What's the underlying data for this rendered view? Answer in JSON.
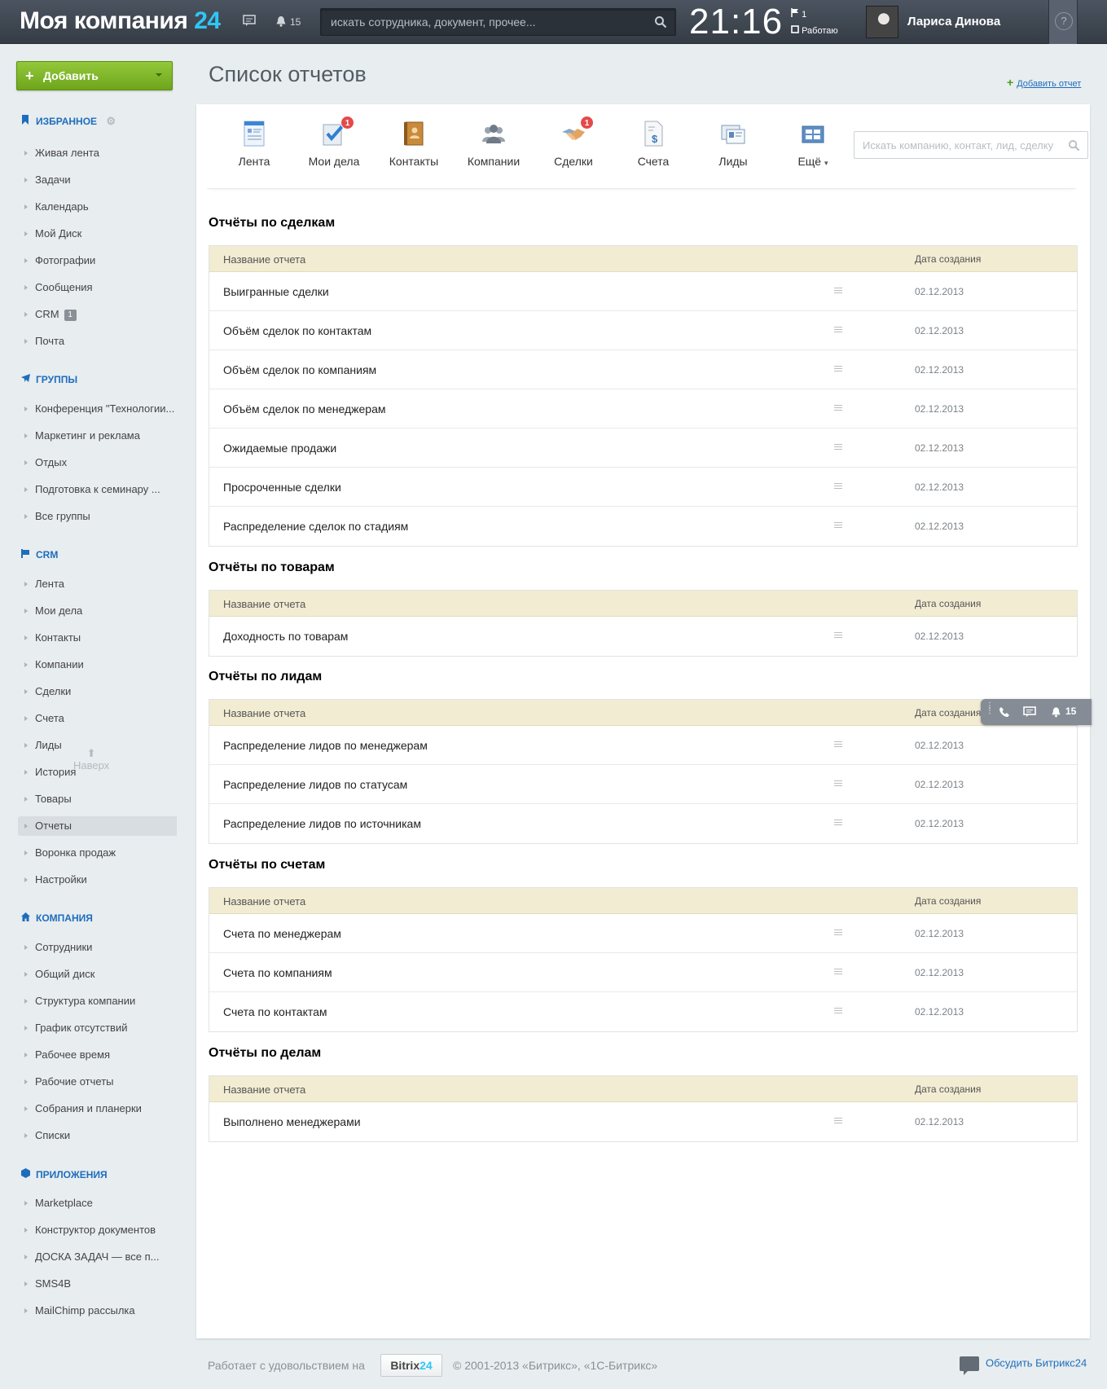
{
  "header": {
    "logo_name": "Моя компания",
    "logo_num": "24",
    "notifications_count": "15",
    "search_placeholder": "искать сотрудника, документ, прочее...",
    "clock": "21:16",
    "flag_count": "1",
    "work_status": "Работаю",
    "user_name": "Лариса Динова",
    "help": "?"
  },
  "sidebar": {
    "add_button": "Добавить",
    "favorites": {
      "title": "Избранное",
      "items": [
        "Живая лента",
        "Задачи",
        "Календарь",
        "Мой Диск",
        "Фотографии",
        "Сообщения",
        "CRM",
        "Почта"
      ],
      "crm_badge": "1"
    },
    "groups": {
      "title": "Группы",
      "items": [
        "Конференция \"Технологии...",
        "Маркетинг и реклама",
        "Отдых",
        "Подготовка к семинару ...",
        "Все группы"
      ]
    },
    "crm": {
      "title": "CRM",
      "items": [
        "Лента",
        "Мои дела",
        "Контакты",
        "Компании",
        "Сделки",
        "Счета",
        "Лиды",
        "История",
        "Товары",
        "Отчеты",
        "Воронка продаж",
        "Настройки"
      ]
    },
    "to_top": "Наверх",
    "company": {
      "title": "Компания",
      "items": [
        "Сотрудники",
        "Общий диск",
        "Структура компании",
        "График отсутствий",
        "Рабочее время",
        "Рабочие отчеты",
        "Собрания и планерки",
        "Списки"
      ]
    },
    "apps": {
      "title": "Приложения",
      "items": [
        "Marketplace",
        "Конструктор документов",
        "ДОСКА ЗАДАЧ — все п...",
        "SMS4B",
        "MailChimp рассылка"
      ]
    }
  },
  "page": {
    "title": "Список отчетов",
    "add_report": "Добавить отчет"
  },
  "toolbar": {
    "items": [
      "Лента",
      "Мои дела",
      "Контакты",
      "Компании",
      "Сделки",
      "Счета",
      "Лиды",
      "Ещё"
    ],
    "badges": {
      "my_tasks": "1",
      "deals": "1"
    },
    "search_placeholder": "Искать компанию, контакт, лид, сделку"
  },
  "reports": {
    "col_name": "Название отчета",
    "col_date": "Дата создания",
    "groups": [
      {
        "title": "Отчёты по сделкам",
        "rows": [
          {
            "name": "Выигранные сделки",
            "date": "02.12.2013"
          },
          {
            "name": "Объём сделок по контактам",
            "date": "02.12.2013"
          },
          {
            "name": "Объём сделок по компаниям",
            "date": "02.12.2013"
          },
          {
            "name": "Объём сделок по менеджерам",
            "date": "02.12.2013"
          },
          {
            "name": "Ожидаемые продажи",
            "date": "02.12.2013"
          },
          {
            "name": "Просроченные сделки",
            "date": "02.12.2013"
          },
          {
            "name": "Распределение сделок по стадиям",
            "date": "02.12.2013"
          }
        ]
      },
      {
        "title": "Отчёты по товарам",
        "rows": [
          {
            "name": "Доходность по товарам",
            "date": "02.12.2013"
          }
        ]
      },
      {
        "title": "Отчёты по лидам",
        "rows": [
          {
            "name": "Распределение лидов по менеджерам",
            "date": "02.12.2013"
          },
          {
            "name": "Распределение лидов по статусам",
            "date": "02.12.2013"
          },
          {
            "name": "Распределение лидов по источникам",
            "date": "02.12.2013"
          }
        ]
      },
      {
        "title": "Отчёты по счетам",
        "rows": [
          {
            "name": "Счета по менеджерам",
            "date": "02.12.2013"
          },
          {
            "name": "Счета по компаниям",
            "date": "02.12.2013"
          },
          {
            "name": "Счета по контактам",
            "date": "02.12.2013"
          }
        ]
      },
      {
        "title": "Отчёты по делам",
        "rows": [
          {
            "name": "Выполнено менеджерами",
            "date": "02.12.2013"
          }
        ]
      }
    ]
  },
  "dock": {
    "notifications": "15"
  },
  "footer": {
    "works_with": "Работает с удовольствием на",
    "bitrix": "Bitrix",
    "bitrix_num": "24",
    "copyright": "© 2001-2013 «Битрикс», «1С-Битрикс»",
    "discuss": "Обсудить Битрикс24"
  },
  "colors": {
    "accent": "#1e6dbd",
    "add_green": "#7fb52a",
    "table_head": "#f2ecd3",
    "header_bg": "#3f4752"
  }
}
